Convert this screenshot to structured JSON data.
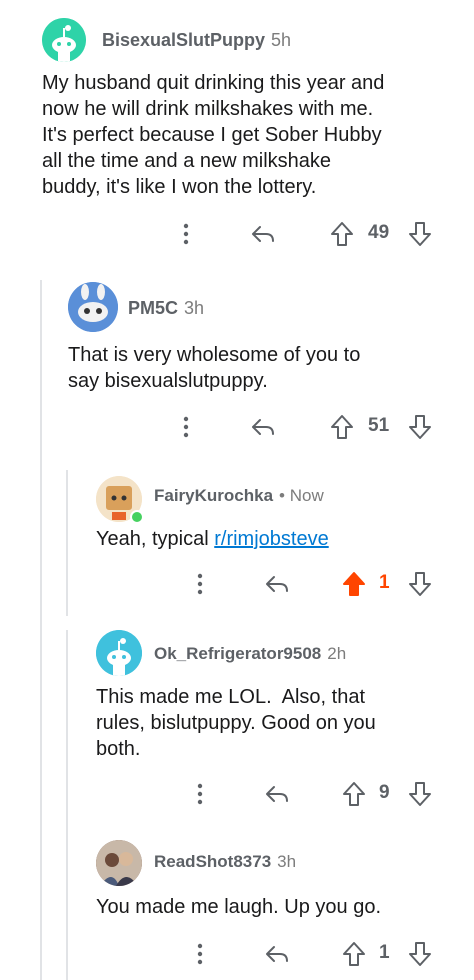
{
  "comments": [
    {
      "author": "BisexualSlutPuppy",
      "meta": "5h",
      "body_lines": [
        "My husband quit drinking this year and",
        "now he will drink milkshakes with me.",
        "It's perfect because I get Sober Hubby",
        "all the time and a new milkshake",
        "buddy, it's like I won the lottery."
      ],
      "score": "49",
      "avatar_color": "#2ed3a8"
    },
    {
      "author": "PM5C",
      "meta": "3h",
      "body_lines": [
        "That is very wholesome of you to",
        "say bisexualslutpuppy."
      ],
      "score": "51",
      "avatar_color": "#5a8fd8"
    },
    {
      "author": "FairyKurochka",
      "meta": "• Now",
      "body_prefix": "Yeah, typical ",
      "body_link": "r/rimjobsteve",
      "score": "1",
      "upvoted": true,
      "avatar_color": "#d9a05b"
    },
    {
      "author": "Ok_Refrigerator9508",
      "meta": "2h",
      "body_lines": [
        "This made me LOL.  Also, that",
        "rules, bislutpuppy. Good on you",
        "both."
      ],
      "score": "9",
      "avatar_color": "#3fc1dd"
    },
    {
      "author": "ReadShot8373",
      "meta": "3h",
      "body_lines": [
        "You made me laugh. Up you go."
      ],
      "score": "1",
      "avatar_color": "#8a6a5a"
    }
  ],
  "colors": {
    "upvote_active": "#ff4500",
    "link": "#0079d3",
    "muted": "#5d6166"
  },
  "icons": [
    "more-icon",
    "reply-icon",
    "upvote-icon",
    "downvote-icon"
  ]
}
